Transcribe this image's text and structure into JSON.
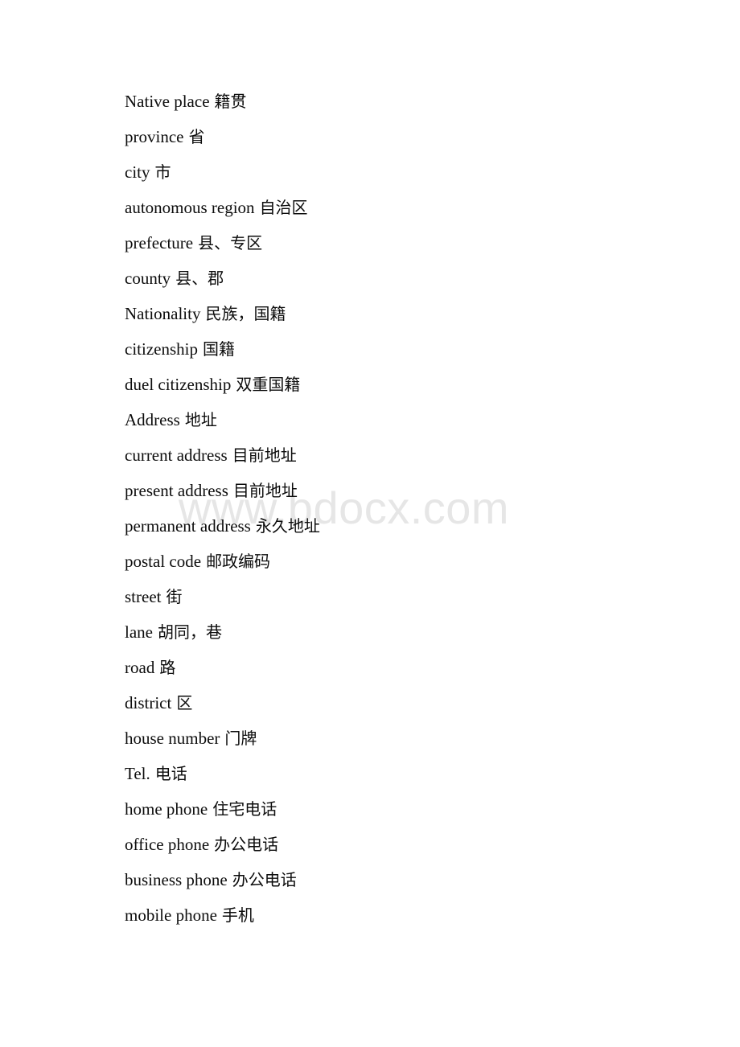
{
  "document": {
    "page_background": "#ffffff",
    "text_color": "#0d0d0d",
    "watermark": {
      "text": "www.bdocx.com",
      "color": "#e6e6e6"
    },
    "glossary": [
      {
        "en": "Native place",
        "zh": "籍贯"
      },
      {
        "en": "province",
        "zh": "省"
      },
      {
        "en": "city",
        "zh": "市"
      },
      {
        "en": "autonomous region",
        "zh": "自治区"
      },
      {
        "en": "prefecture",
        "zh": "县、专区"
      },
      {
        "en": "county",
        "zh": "县、郡"
      },
      {
        "en": "Nationality",
        "zh": "民族，国籍"
      },
      {
        "en": "citizenship",
        "zh": "国籍"
      },
      {
        "en": "duel citizenship",
        "zh": "双重国籍"
      },
      {
        "en": "Address",
        "zh": "地址"
      },
      {
        "en": "current address",
        "zh": "目前地址"
      },
      {
        "en": "present address",
        "zh": "目前地址"
      },
      {
        "en": "permanent address",
        "zh": "永久地址"
      },
      {
        "en": "postal code",
        "zh": "邮政编码"
      },
      {
        "en": "street",
        "zh": "街"
      },
      {
        "en": "lane",
        "zh": "胡同，巷"
      },
      {
        "en": "road",
        "zh": "路"
      },
      {
        "en": "district",
        "zh": "区"
      },
      {
        "en": "house number",
        "zh": "门牌"
      },
      {
        "en": "Tel.",
        "zh": "电话"
      },
      {
        "en": "home phone",
        "zh": "住宅电话"
      },
      {
        "en": "office phone",
        "zh": "办公电话"
      },
      {
        "en": "business phone",
        "zh": "办公电话"
      },
      {
        "en": "mobile phone",
        "zh": "手机"
      }
    ]
  }
}
